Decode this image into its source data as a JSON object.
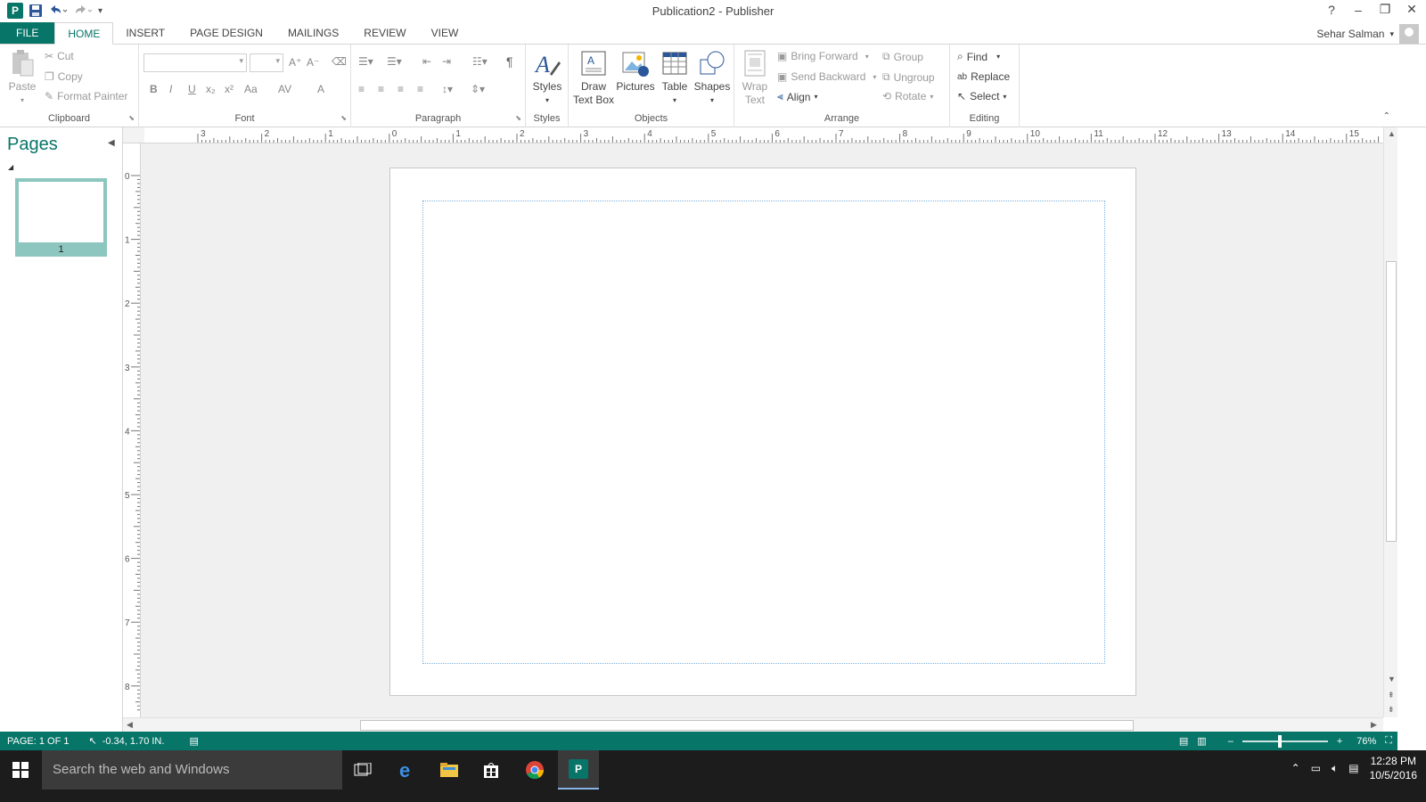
{
  "window": {
    "title": "Publication2 - Publisher",
    "help": "?",
    "minimize": "–",
    "restore": "❐",
    "close": "✕"
  },
  "qat": {
    "customize": "▾"
  },
  "tabs": [
    {
      "label": "FILE"
    },
    {
      "label": "HOME"
    },
    {
      "label": "INSERT"
    },
    {
      "label": "PAGE DESIGN"
    },
    {
      "label": "MAILINGS"
    },
    {
      "label": "REVIEW"
    },
    {
      "label": "VIEW"
    }
  ],
  "user": {
    "name": "Sehar Salman"
  },
  "ribbon": {
    "clipboard": {
      "label": "Clipboard",
      "paste": "Paste",
      "cut": "Cut",
      "copy": "Copy",
      "format_painter": "Format Painter"
    },
    "font": {
      "label": "Font",
      "bold": "B",
      "italic": "I",
      "underline": "U",
      "subscript": "x₂",
      "superscript": "x²",
      "change_case": "Aa",
      "char_spacing": "AV",
      "font_color": "A",
      "grow": "A⁺",
      "shrink": "A⁻"
    },
    "paragraph": {
      "label": "Paragraph",
      "pilcrow": "¶"
    },
    "styles": {
      "label": "Styles",
      "button": "Styles"
    },
    "objects": {
      "label": "Objects",
      "draw_text_box_line1": "Draw",
      "draw_text_box_line2": "Text Box",
      "pictures": "Pictures",
      "table": "Table",
      "shapes": "Shapes"
    },
    "arrange": {
      "label": "Arrange",
      "wrap_text_line1": "Wrap",
      "wrap_text_line2": "Text",
      "bring_forward": "Bring Forward",
      "send_backward": "Send Backward",
      "align": "Align",
      "group": "Group",
      "ungroup": "Ungroup",
      "rotate": "Rotate"
    },
    "editing": {
      "label": "Editing",
      "find": "Find",
      "replace": "Replace",
      "select": "Select"
    }
  },
  "pages_pane": {
    "title": "Pages",
    "pages": [
      {
        "number": "1"
      }
    ]
  },
  "rulers": {
    "horizontal_labels": [
      "3",
      "2",
      "1",
      "0",
      "1",
      "2",
      "3",
      "4",
      "5",
      "6",
      "7",
      "8",
      "9",
      "10",
      "11",
      "12",
      "13",
      "14",
      "15"
    ],
    "vertical_labels": [
      "0",
      "1",
      "2",
      "3",
      "4",
      "5",
      "6",
      "7",
      "8"
    ]
  },
  "status": {
    "page": "PAGE: 1 OF 1",
    "position": "-0.34, 1.70 IN.",
    "zoom": "76%",
    "zoom_minus": "–",
    "zoom_plus": "+",
    "zoom_level": 0.44
  },
  "taskbar": {
    "search_placeholder": "Search the web and Windows",
    "time": "12:28 PM",
    "date": "10/5/2016"
  },
  "colors": {
    "accent": "#077568",
    "taskbar": "#1c1c1c",
    "thumb_selected": "#8dc6bf"
  }
}
